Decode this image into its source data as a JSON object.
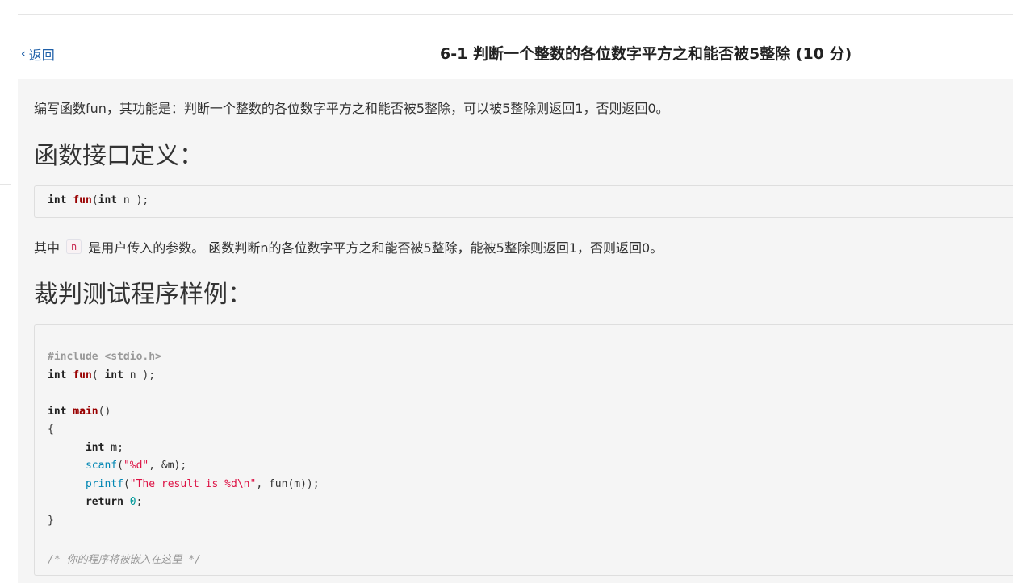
{
  "header": {
    "back_label": "返回",
    "title": "6-1 判断一个整数的各位数字平方之和能否被5整除 (10 分)"
  },
  "content": {
    "intro": "编写函数fun，其功能是：判断一个整数的各位数字平方之和能否被5整除，可以被5整除则返回1，否则返回0。",
    "heading_interface": "函数接口定义：",
    "interface_code": {
      "t1": "int",
      "t2": "fun",
      "t3": "(",
      "t4": "int",
      "t5": " n );"
    },
    "param_prefix": "其中",
    "param_name": "n",
    "param_suffix": "是用户传入的参数。 函数判断n的各位数字平方之和能否被5整除，能被5整除则返回1，否则返回0。",
    "heading_sample": "裁判测试程序样例：",
    "sample_code": {
      "include": "#include <stdio.h>",
      "decl_int": "int",
      "decl_fun": "fun",
      "decl_open": "( ",
      "decl_int2": "int",
      "decl_rest": " n );",
      "main_int": "int",
      "main_name": "main",
      "main_parens": "()",
      "brace_open": "{",
      "m_int": "int",
      "m_rest": " m;",
      "scanf": "scanf",
      "scanf_open": "(",
      "scanf_str": "\"%d\"",
      "scanf_rest": ", &m);",
      "printf": "printf",
      "printf_open": "(",
      "printf_str": "\"The result is %d\\n\"",
      "printf_rest": ", fun(m));",
      "ret": "return",
      "ret_space": " ",
      "ret_num": "0",
      "ret_semi": ";",
      "brace_close": "}",
      "comment": "/* 你的程序将被嵌入在这里 */"
    }
  }
}
